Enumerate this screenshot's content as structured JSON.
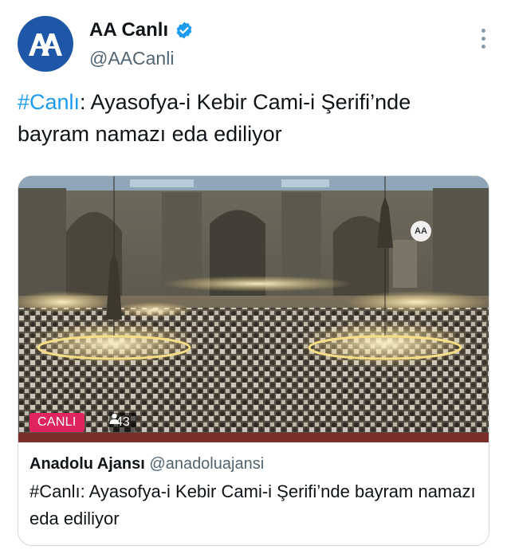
{
  "author": {
    "name": "AA Canlı",
    "handle": "@AACanli",
    "avatar_text": "AA",
    "verified": true
  },
  "tweet": {
    "hashtag": "#Canlı",
    "text_rest": ": Ayasofya-i Kebir Cami-i Şerifi’nde bayram namazı eda ediliyor"
  },
  "media": {
    "live_badge": "CANLI",
    "viewer_count": "43",
    "watermark": "AA"
  },
  "card": {
    "author_name": "Anadolu Ajansı",
    "author_handle": "@anadoluajansi",
    "text": "#Canlı: Ayasofya-i Kebir Cami-i Şerifi’nde bayram namazı eda ediliyor"
  },
  "colors": {
    "accent": "#1d9bf0",
    "avatar_bg": "#1f57a8",
    "live_red": "#e0245e",
    "secondary_text": "#536471"
  }
}
